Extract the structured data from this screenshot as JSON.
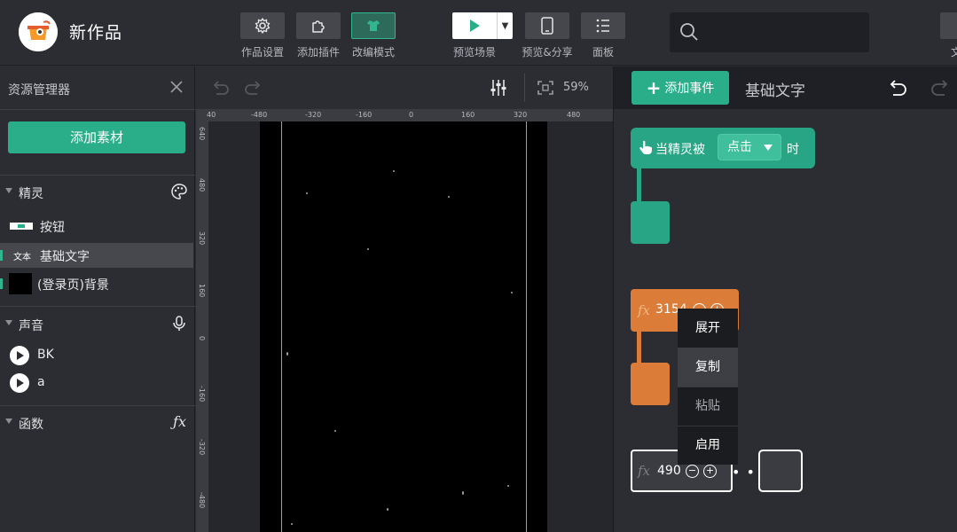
{
  "header": {
    "app_title": "新作品",
    "tools": [
      {
        "label": "作品设置",
        "icon": "gear-icon"
      },
      {
        "label": "添加插件",
        "icon": "puzzle-icon"
      },
      {
        "label": "改编模式",
        "icon": "shirt-icon"
      }
    ],
    "preview_scene_label": "预览场景",
    "preview_share_label": "预览&分享",
    "panel_label": "面板",
    "search_placeholder": "",
    "file_label": "文",
    "colors": {
      "accent": "#2aae8a",
      "active_border": "#32b690"
    }
  },
  "asset_panel": {
    "title": "资源管理器",
    "add_asset_label": "添加素材",
    "sections": {
      "sprites": {
        "label": "精灵",
        "items": [
          {
            "label": "按钮",
            "thumb": "button-thumb"
          },
          {
            "label": "基础文字",
            "thumb": "text-thumb",
            "thumb_text": "文本",
            "selected": true
          },
          {
            "label": "(登录页)背景",
            "thumb": "black-bg-thumb"
          }
        ]
      },
      "sounds": {
        "label": "声音",
        "items": [
          {
            "label": "BK"
          },
          {
            "label": "a"
          }
        ]
      },
      "functions": {
        "label": "函数"
      }
    }
  },
  "stage": {
    "zoom": "59%",
    "ruler_top": [
      "40",
      "-480",
      "-320",
      "-160",
      "0",
      "160",
      "320",
      "480"
    ],
    "ruler_left": [
      "640",
      "480",
      "320",
      "160",
      "0",
      "-160",
      "-320",
      "-480"
    ]
  },
  "block_editor": {
    "add_event_label": "添加事件",
    "context_title": "基础文字",
    "hat_block": {
      "prefix": "当精灵被",
      "dropdown": "点击",
      "suffix": "时"
    },
    "fx_block": {
      "fx": "fx",
      "value": "3154"
    },
    "ghost_block": {
      "fx": "fx",
      "value": "490"
    },
    "context_menu": [
      "展开",
      "复制",
      "粘贴",
      "启用"
    ]
  }
}
